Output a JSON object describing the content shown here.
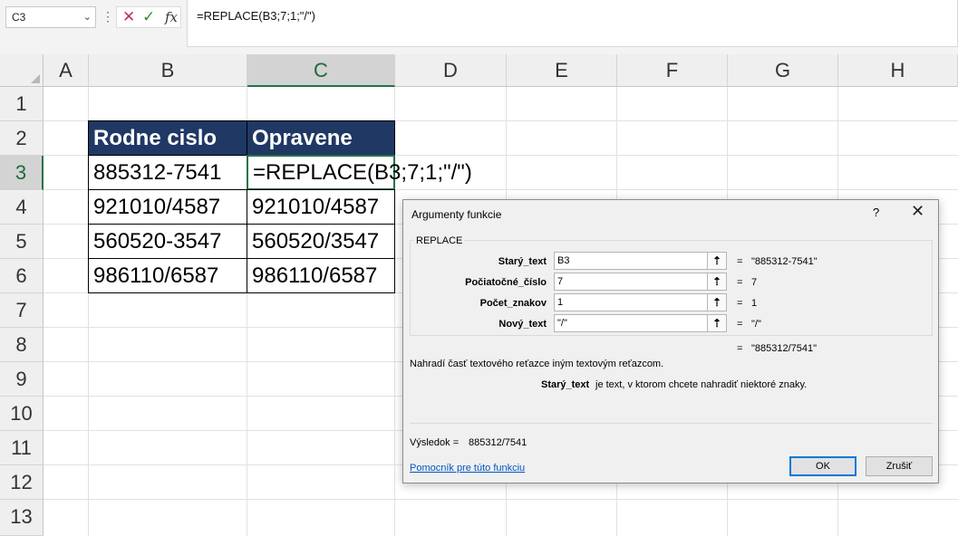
{
  "formula_bar": {
    "name_box": "C3",
    "chevron": "⌄",
    "dots": "⋮",
    "cancel_icon": "✕",
    "enter_icon": "✓",
    "fx_label": "fx",
    "formula": "=REPLACE(B3;7;1;\"/\")"
  },
  "columns": [
    "A",
    "B",
    "C",
    "D",
    "E",
    "F",
    "G",
    "H"
  ],
  "rows": [
    "1",
    "2",
    "3",
    "4",
    "5",
    "6",
    "7",
    "8",
    "9",
    "10",
    "11",
    "12",
    "13"
  ],
  "selected_column": "C",
  "selected_row": "3",
  "table": {
    "header": [
      "Rodne cislo",
      "Opravene"
    ],
    "rows": [
      [
        "885312-7541",
        "=REPLACE(B3;7;1;\"/\")"
      ],
      [
        "921010/4587",
        "921010/4587"
      ],
      [
        "560520-3547",
        "560520/3547"
      ],
      [
        "986110/6587",
        "986110/6587"
      ]
    ],
    "header_bg": "#203864"
  },
  "dialog": {
    "title": "Argumenty funkcie",
    "help_icon": "?",
    "close_icon": "✕",
    "function_name": "REPLACE",
    "args": [
      {
        "label": "Starý_text",
        "value": "B3",
        "result": "\"885312-7541\""
      },
      {
        "label": "Počiatočné_číslo",
        "value": "7",
        "result": "7"
      },
      {
        "label": "Počet_znakov",
        "value": "1",
        "result": "1"
      },
      {
        "label": "Nový_text",
        "value": "\"/\"",
        "result": "\"/\""
      }
    ],
    "ref_icon": "⇡",
    "eq": "=",
    "formula_result": "\"885312/7541\"",
    "description": "Nahradí časť textového reťazce iným textovým reťazcom.",
    "arg_name": "Starý_text",
    "arg_description": "je text, v ktorom chcete nahradiť niektoré znaky.",
    "result_label": "Výsledok =",
    "result_value": "885312/7541",
    "help_link": "Pomocník pre túto funkciu",
    "ok_label": "OK",
    "cancel_label": "Zrušiť"
  },
  "colors": {
    "accent": "#217346",
    "link": "#0056c0"
  }
}
